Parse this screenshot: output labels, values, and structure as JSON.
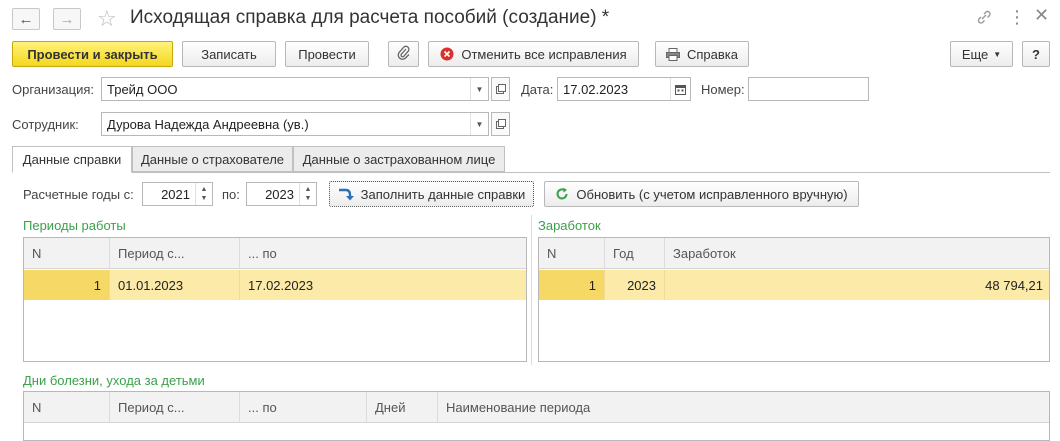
{
  "window": {
    "title": "Исходящая справка для расчета пособий (создание) *",
    "back_icon": "arrow-left-icon",
    "forward_icon": "arrow-right-icon",
    "favorite_icon": "star-icon"
  },
  "toolbar": {
    "post_close": "Провести и закрыть",
    "save": "Записать",
    "post": "Провести",
    "cancel_corrections": "Отменить все исправления",
    "report": "Справка",
    "more": "Еще",
    "help": "?"
  },
  "form": {
    "organization_label": "Организация:",
    "organization_value": "Трейд ООО",
    "date_label": "Дата:",
    "date_value": "17.02.2023",
    "number_label": "Номер:",
    "number_value": "",
    "employee_label": "Сотрудник:",
    "employee_value": "Дурова Надежда Андреевна (ув.)"
  },
  "tabs": [
    {
      "label": "Данные справки",
      "active": true
    },
    {
      "label": "Данные о страхователе",
      "active": false
    },
    {
      "label": "Данные о застрахованном лице",
      "active": false
    }
  ],
  "years": {
    "from_label": "Расчетные годы с:",
    "from_value": "2021",
    "to_label": "по:",
    "to_value": "2023",
    "fill_button": "Заполнить данные справки",
    "refresh_button": "Обновить (с учетом исправленного вручную)"
  },
  "periods": {
    "title": "Периоды работы",
    "columns": [
      "N",
      "Период с...",
      "... по"
    ],
    "rows": [
      {
        "n": "1",
        "from": "01.01.2023",
        "to": "17.02.2023"
      }
    ]
  },
  "earnings": {
    "title": "Заработок",
    "columns": [
      "N",
      "Год",
      "Заработок"
    ],
    "rows": [
      {
        "n": "1",
        "year": "2023",
        "amount": "48 794,21"
      }
    ]
  },
  "sick_days": {
    "title": "Дни болезни, ухода за детьми",
    "columns": [
      "N",
      "Период с...",
      "... по",
      "Дней",
      "Наименование периода"
    ]
  },
  "colors": {
    "primary_button": "#f4d71e",
    "group_title": "#3aa14a",
    "selected_row": "#fbeaa8",
    "cancel_icon": "#d9322b",
    "refresh_icon": "#3aa14a"
  }
}
